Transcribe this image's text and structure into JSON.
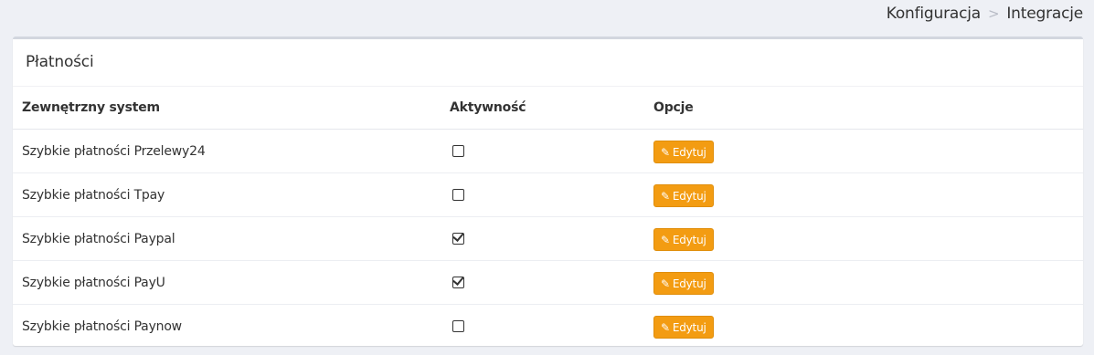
{
  "breadcrumb": {
    "items": [
      "Konfiguracja",
      "Integracje"
    ],
    "separator": ">"
  },
  "panel": {
    "title": "Płatności"
  },
  "table": {
    "headers": [
      "Zewnętrzny system",
      "Aktywność",
      "Opcje"
    ],
    "rows": [
      {
        "name": "Szybkie płatności Przelewy24",
        "active": false,
        "action": "Edytuj"
      },
      {
        "name": "Szybkie płatności Tpay",
        "active": false,
        "action": "Edytuj"
      },
      {
        "name": "Szybkie płatności Paypal",
        "active": true,
        "action": "Edytuj"
      },
      {
        "name": "Szybkie płatności PayU",
        "active": true,
        "action": "Edytuj"
      },
      {
        "name": "Szybkie płatności Paynow",
        "active": false,
        "action": "Edytuj"
      }
    ]
  },
  "icons": {
    "edit": "pencil-icon"
  },
  "colors": {
    "edit_button": "#f39c12",
    "background": "#eef0f5"
  }
}
